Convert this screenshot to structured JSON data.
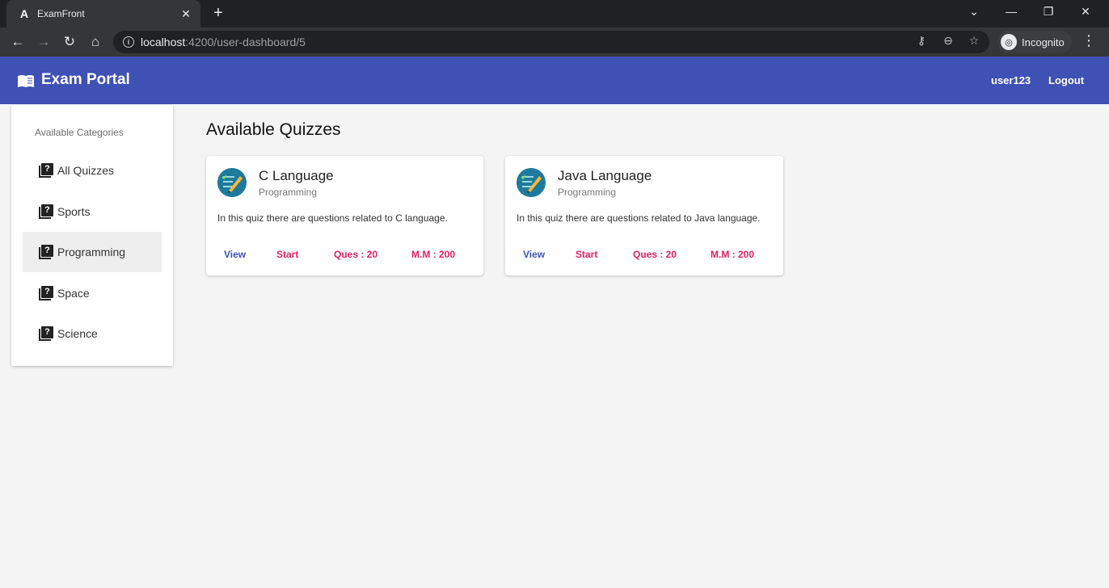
{
  "browser": {
    "tab_title": "ExamFront",
    "url_host": "localhost",
    "url_rest": ":4200/user-dashboard/5",
    "incognito_label": "Incognito"
  },
  "navbar": {
    "brand": "Exam Portal",
    "username": "user123",
    "logout": "Logout",
    "color": "#3f51b5"
  },
  "sidebar": {
    "heading": "Available Categories",
    "items": [
      {
        "label": "All Quizzes",
        "active": false
      },
      {
        "label": "Sports",
        "active": false
      },
      {
        "label": "Programming",
        "active": true
      },
      {
        "label": "Space",
        "active": false
      },
      {
        "label": "Science",
        "active": false
      }
    ]
  },
  "main": {
    "title": "Available Quizzes",
    "quizzes": [
      {
        "title": "C Language",
        "category": "Programming",
        "description": "In this quiz there are questions related to C language.",
        "view": "View",
        "start": "Start",
        "questions": "Ques : 20",
        "max_marks": "M.M : 200"
      },
      {
        "title": "Java Language",
        "category": "Programming",
        "description": "In this quiz there are questions related to Java language.",
        "view": "View",
        "start": "Start",
        "questions": "Ques : 20",
        "max_marks": "M.M : 200"
      }
    ]
  },
  "colors": {
    "primary": "#3f51b5",
    "accent": "#e91e63"
  }
}
